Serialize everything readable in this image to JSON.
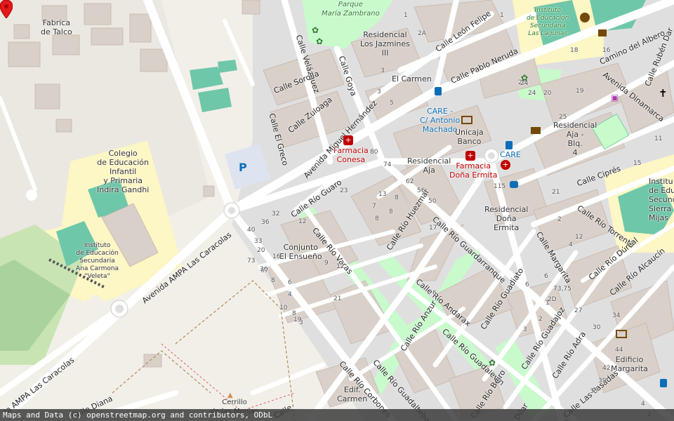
{
  "map": {
    "attribution": "Maps and Data (c) openstreetmap.org and contributors, ODbL",
    "places": {
      "fabrica": "Fabrica\nde Talco",
      "colegio": "Colegio\nde Educación\nInfantil\ny Primaria\nIndira Gandhi",
      "instituto_carmona": "Instituto\nde Educación\nSecundaria\nAna Carmona\n\"Veleta\"",
      "parque": "Parque\nMaría Zambrano",
      "residencial_jazmines": "Residencial\nLos Jazmines\nIII",
      "el_carmen": "El Carmen",
      "instituto_lagunas": "Instituto\nde Educación\nSecundaria\nLas Lagunas",
      "farmacia_conesa": "Farmacia\nConesa",
      "care_bus": "CARE -\nC/ Antonio\nMachado",
      "unicaja": "Unicaja\nBanco",
      "residencial_aja": "Residencial\nAja",
      "farmacia_ermita": "Farmacia\nDoña Ermita",
      "care2": "CARE",
      "residencial_aja_blq": "Residencial\nAja -\nBlq.\n4",
      "instituto_sierra": "Institu\nde Educa\nSecund\nSierra\nMijas",
      "residencial_ermita": "Residencial\nDoña\nErmita",
      "conjunto": "Conjunto\nEl Ensueño",
      "edificio_margarita": "Edificio\nMargarita",
      "edif_carmen": "Edif.\nCarmen",
      "cerrillo": "Cerrillo\nde las Monjas",
      "parking": "P"
    },
    "streets": {
      "caracolas1": "Avenida AMPA Las Caracolas",
      "caracolas2": "da AMPA Las Caracolas",
      "velazquez": "Calle Velázquez",
      "goya": "Calle Goya",
      "sorolla": "Calle Sorolla",
      "zuloaga": "Calle Zuloaga",
      "greco": "Calle El Greco",
      "miguel_hernandez": "Avenida Miguel Hernández",
      "leon_felipe": "Calle León Felipe",
      "pablo_neruda": "Calle Pablo Neruda",
      "camino_albero": "Camino del Albero",
      "ruben_dario": "Calle Rubén Dar",
      "dinamarca": "Avenida Dinamarca",
      "cipres": "Calle Ciprés",
      "rio_torrente": "Calle Río Torrente",
      "rio_durcal": "Calle Río Dúrcal",
      "rio_alcaucin": "Calle Río Alcaucín",
      "margarita": "Calle Margarita",
      "rio_guaro": "Calle Río Guaro",
      "rio_varas": "Calle Río Varas",
      "rio_huezmar": "Calle Río Huezmar",
      "rio_guardarranque": "Calle Río Guardarranque",
      "rio_andarax": "Calle Río Andarax",
      "rio_guadiato": "Calle Río Guadiato",
      "rio_anzur": "Calle Río Anzur",
      "rio_guadalevin": "Calle Río Guadalevín",
      "rio_guadajoz": "Calle Río Guadajoz",
      "rio_adra": "Calle Río Adra",
      "rio_guadalteba": "Calle Río Guadalteba",
      "rio_corbones": "Calle Río Corbones",
      "rio_beiro": "Calle Río Beiro",
      "las_pasadas": "Calle Las Pasadas",
      "diana": "Calle Diana",
      "dilar": "Dilar",
      "calle_bottom": "Calle"
    },
    "house_numbers": [
      "1",
      "2A",
      "1",
      "3",
      "3",
      "5",
      "18",
      "16",
      "26",
      "24",
      "20",
      "19",
      "25",
      "80",
      "74",
      "62",
      "56",
      "50",
      "36",
      "32",
      "40",
      "33",
      "20",
      "73",
      "16",
      "67",
      "8",
      "6",
      "4",
      "10",
      "8",
      "3",
      "9",
      "13",
      "7",
      "8",
      "12",
      "17",
      "23",
      "19",
      "12",
      "8",
      "15",
      "115",
      "11",
      "21",
      "6",
      "2",
      "12",
      "1",
      "2",
      "3",
      "4",
      "8",
      "24",
      "36",
      "6",
      "73,75",
      "2D",
      "27",
      "34",
      "30",
      "44",
      "42",
      "39",
      "35",
      "6",
      "4",
      "2",
      "21"
    ]
  }
}
